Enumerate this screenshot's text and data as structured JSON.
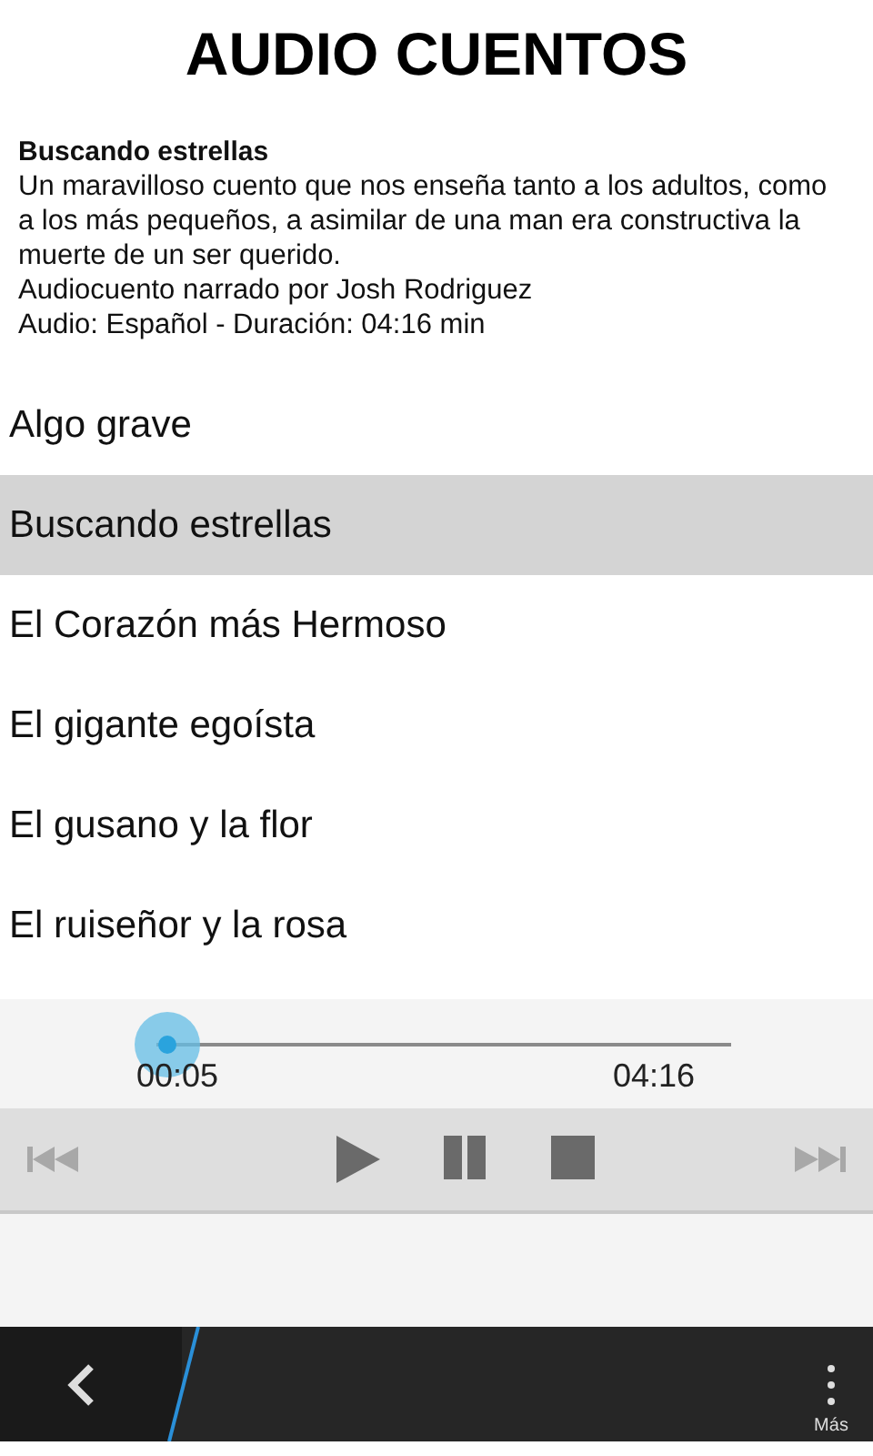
{
  "title": "AUDIO CUENTOS",
  "info": {
    "heading": "Buscando estrellas",
    "description": "Un maravilloso cuento que nos enseña tanto a los adultos, como a los más pequeños, a asimilar de una man era constructiva la muerte de un ser querido.",
    "narrator": "Audiocuento narrado por Josh Rodriguez",
    "audio": "Audio: Español - Duración: 04:16 min"
  },
  "stories": [
    {
      "label": "Algo grave",
      "selected": false
    },
    {
      "label": "Buscando estrellas",
      "selected": true
    },
    {
      "label": "El Corazón más Hermoso",
      "selected": false
    },
    {
      "label": "El gigante egoísta",
      "selected": false
    },
    {
      "label": "El gusano y la flor",
      "selected": false
    },
    {
      "label": "El ruiseñor y la rosa",
      "selected": false
    }
  ],
  "player": {
    "level": 0.02,
    "elapsed": "00:05",
    "total": "04:16",
    "controls": [
      {
        "kind": "previous",
        "disabled": true
      },
      {
        "kind": "play",
        "disabled": false
      },
      {
        "kind": "pause",
        "disabled": false
      },
      {
        "kind": "stop",
        "disabled": false
      },
      {
        "kind": "next",
        "disabled": true
      }
    ]
  },
  "action_bar": {
    "more_label": "Más"
  }
}
